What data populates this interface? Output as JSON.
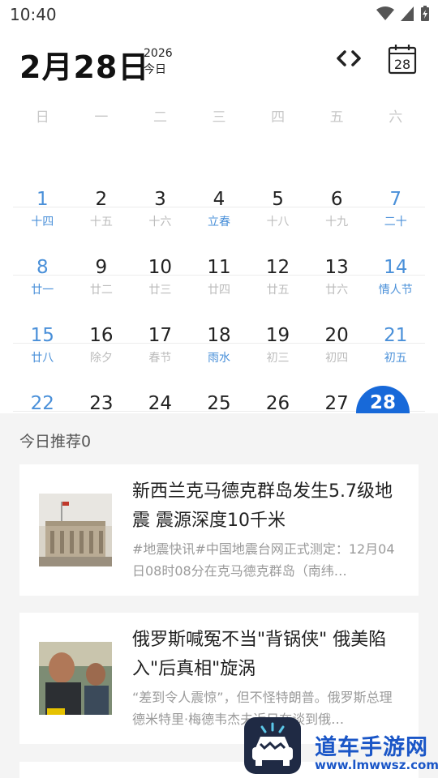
{
  "status_bar": {
    "time": "10:40"
  },
  "header": {
    "date": "2月28日",
    "year": "2026",
    "today_label": "今日",
    "calendar_icon_day": "28"
  },
  "weekdays": [
    "日",
    "一",
    "二",
    "三",
    "四",
    "五",
    "六"
  ],
  "calendar_rows": [
    [
      {
        "day": "1",
        "lunar": "十四",
        "blue_day": true,
        "blue_lunar": true
      },
      {
        "day": "2",
        "lunar": "十五",
        "blue_day": false,
        "blue_lunar": false
      },
      {
        "day": "3",
        "lunar": "十六",
        "blue_day": false,
        "blue_lunar": false
      },
      {
        "day": "4",
        "lunar": "立春",
        "blue_day": false,
        "blue_lunar": true
      },
      {
        "day": "5",
        "lunar": "十八",
        "blue_day": false,
        "blue_lunar": false
      },
      {
        "day": "6",
        "lunar": "十九",
        "blue_day": false,
        "blue_lunar": false
      },
      {
        "day": "7",
        "lunar": "二十",
        "blue_day": true,
        "blue_lunar": true
      }
    ],
    [
      {
        "day": "8",
        "lunar": "廿一",
        "blue_day": true,
        "blue_lunar": true
      },
      {
        "day": "9",
        "lunar": "廿二",
        "blue_day": false,
        "blue_lunar": false
      },
      {
        "day": "10",
        "lunar": "廿三",
        "blue_day": false,
        "blue_lunar": false
      },
      {
        "day": "11",
        "lunar": "廿四",
        "blue_day": false,
        "blue_lunar": false
      },
      {
        "day": "12",
        "lunar": "廿五",
        "blue_day": false,
        "blue_lunar": false
      },
      {
        "day": "13",
        "lunar": "廿六",
        "blue_day": false,
        "blue_lunar": false
      },
      {
        "day": "14",
        "lunar": "情人节",
        "blue_day": true,
        "blue_lunar": true
      }
    ],
    [
      {
        "day": "15",
        "lunar": "廿八",
        "blue_day": true,
        "blue_lunar": true
      },
      {
        "day": "16",
        "lunar": "除夕",
        "blue_day": false,
        "blue_lunar": false
      },
      {
        "day": "17",
        "lunar": "春节",
        "blue_day": false,
        "blue_lunar": false
      },
      {
        "day": "18",
        "lunar": "雨水",
        "blue_day": false,
        "blue_lunar": true
      },
      {
        "day": "19",
        "lunar": "初三",
        "blue_day": false,
        "blue_lunar": false
      },
      {
        "day": "20",
        "lunar": "初四",
        "blue_day": false,
        "blue_lunar": false
      },
      {
        "day": "21",
        "lunar": "初五",
        "blue_day": true,
        "blue_lunar": true
      }
    ],
    [
      {
        "day": "22",
        "lunar": "",
        "blue_day": true,
        "blue_lunar": false
      },
      {
        "day": "23",
        "lunar": "",
        "blue_day": false,
        "blue_lunar": false
      },
      {
        "day": "24",
        "lunar": "",
        "blue_day": false,
        "blue_lunar": false
      },
      {
        "day": "25",
        "lunar": "",
        "blue_day": false,
        "blue_lunar": false
      },
      {
        "day": "26",
        "lunar": "",
        "blue_day": false,
        "blue_lunar": false
      },
      {
        "day": "27",
        "lunar": "",
        "blue_day": false,
        "blue_lunar": false
      },
      {
        "day": "28",
        "lunar": "",
        "blue_day": false,
        "blue_lunar": false,
        "selected": true
      }
    ]
  ],
  "recommend": {
    "title": "今日推荐0",
    "articles": [
      {
        "title": "新西兰克马德克群岛发生5.7级地震 震源深度10千米",
        "desc": "#地震快讯#中国地震台网正式测定：12月04日08时08分在克马德克群岛（南纬…"
      },
      {
        "title": "俄罗斯喊冤不当\"背锅侠\" 俄美陷入\"后真相\"旋涡",
        "desc": "“差到令人震惊”，但不怪特朗普。俄罗斯总理德米特里·梅德韦杰夫近日在谈到俄…"
      }
    ]
  },
  "watermark": {
    "line1": "道车手游网",
    "line2": "www.lmwwsz.com"
  },
  "colors": {
    "accent": "#4a90d9",
    "selected": "#1769d9",
    "panel_bg": "#f4f4f4"
  }
}
